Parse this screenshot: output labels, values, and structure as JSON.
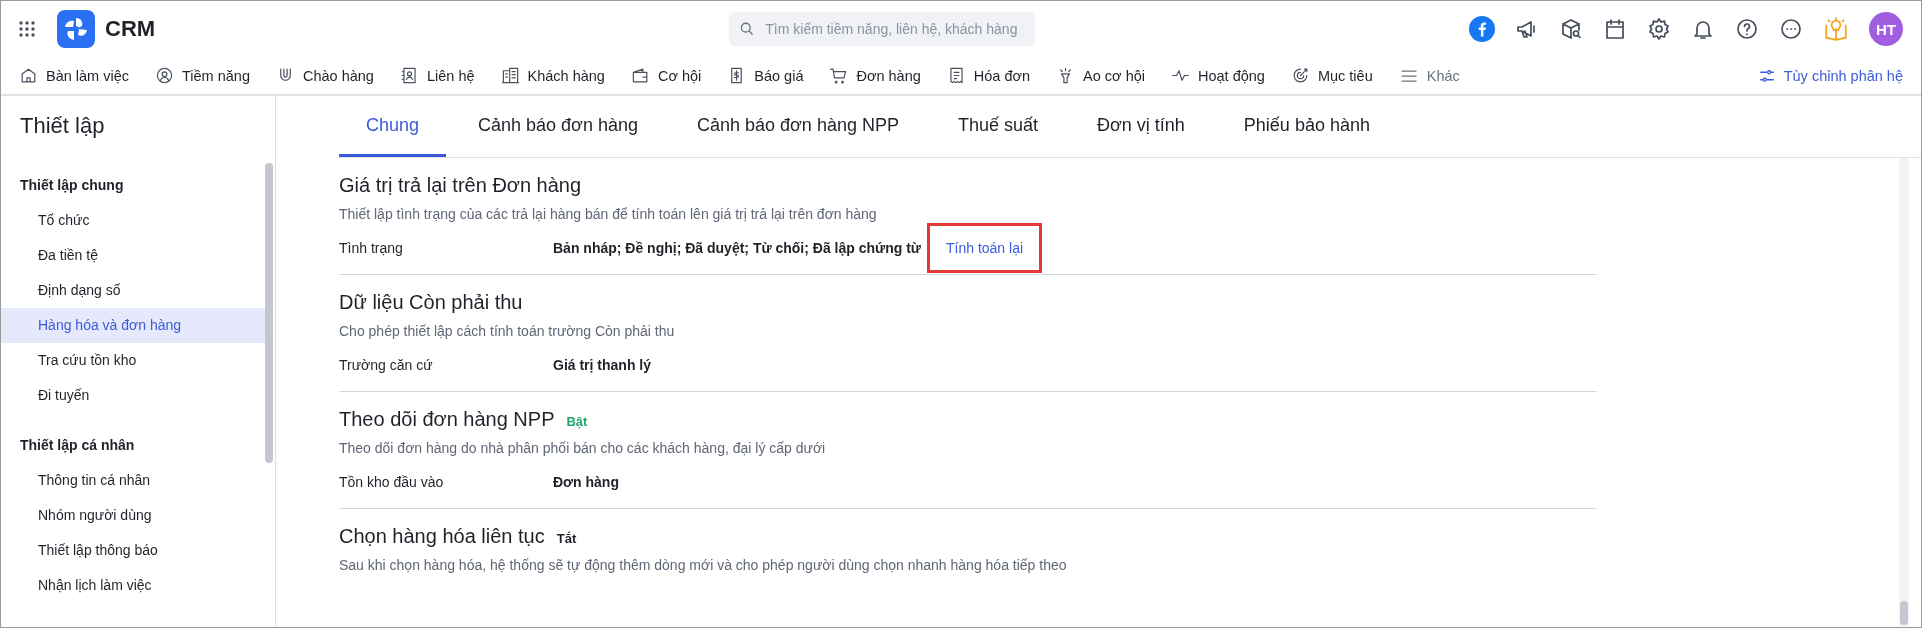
{
  "app": {
    "name": "CRM"
  },
  "search": {
    "placeholder": "Tìm kiếm tiềm năng, liên hệ, khách hàng"
  },
  "user": {
    "initials": "HT"
  },
  "nav": [
    {
      "label": "Bàn làm việc"
    },
    {
      "label": "Tiềm năng"
    },
    {
      "label": "Chào hàng"
    },
    {
      "label": "Liên hệ"
    },
    {
      "label": "Khách hàng"
    },
    {
      "label": "Cơ hội"
    },
    {
      "label": "Báo giá"
    },
    {
      "label": "Đơn hàng"
    },
    {
      "label": "Hóa đơn"
    },
    {
      "label": "Ao cơ hội"
    },
    {
      "label": "Hoạt động"
    },
    {
      "label": "Mục tiêu"
    }
  ],
  "nav_more": {
    "label": "Khác"
  },
  "customize": {
    "label": "Tùy chỉnh phân hệ"
  },
  "sidebar": {
    "title": "Thiết lập",
    "groups": [
      {
        "heading": "Thiết lập chung",
        "items": [
          {
            "label": "Tổ chức",
            "selected": false
          },
          {
            "label": "Đa tiền tệ",
            "selected": false
          },
          {
            "label": "Định dạng số",
            "selected": false
          },
          {
            "label": "Hàng hóa và đơn hàng",
            "selected": true
          },
          {
            "label": "Tra cứu tồn kho",
            "selected": false
          },
          {
            "label": "Đi tuyến",
            "selected": false
          }
        ]
      },
      {
        "heading": "Thiết lập cá nhân",
        "items": [
          {
            "label": "Thông tin cá nhân",
            "selected": false
          },
          {
            "label": "Nhóm người dùng",
            "selected": false
          },
          {
            "label": "Thiết lập thông báo",
            "selected": false
          },
          {
            "label": "Nhận lịch làm việc",
            "selected": false
          }
        ]
      }
    ]
  },
  "tabs": [
    {
      "label": "Chung",
      "selected": true
    },
    {
      "label": "Cảnh báo đơn hàng",
      "selected": false
    },
    {
      "label": "Cảnh báo đơn hàng NPP",
      "selected": false
    },
    {
      "label": "Thuế suất",
      "selected": false
    },
    {
      "label": "Đơn vị tính",
      "selected": false
    },
    {
      "label": "Phiếu bảo hành",
      "selected": false
    }
  ],
  "sections": [
    {
      "title": "Giá trị trả lại trên Đơn hàng",
      "description": "Thiết lập tình trạng của các trả lại hàng bán để tính toán lên giá trị trả lại trên đơn hàng",
      "rows": [
        {
          "label": "Tình trạng",
          "value": "Bản nháp; Đề nghị; Đã duyệt; Từ chối; Đã lập chứng từ",
          "action": {
            "label": "Tính toán lại",
            "highlighted": true
          }
        }
      ]
    },
    {
      "title": "Dữ liệu Còn phải thu",
      "description": "Cho phép thiết lập cách tính toán trường Còn phải thu",
      "rows": [
        {
          "label": "Trường căn cứ",
          "value": "Giá trị thanh lý"
        }
      ]
    },
    {
      "title": "Theo dõi đơn hàng NPP",
      "status": {
        "label": "Bật",
        "kind": "on"
      },
      "description": "Theo dõi đơn hàng do nhà phân phối bán cho các khách hàng, đại lý cấp dưới",
      "rows": [
        {
          "label": "Tồn kho đầu vào",
          "value": "Đơn hàng"
        }
      ]
    },
    {
      "title": "Chọn hàng hóa liên tục",
      "status": {
        "label": "Tắt",
        "kind": "off"
      },
      "description": "Sau khi chọn hàng hóa, hệ thống sẽ tự động thêm dòng mới và cho phép người dùng chọn nhanh hàng hóa tiếp theo"
    }
  ]
}
